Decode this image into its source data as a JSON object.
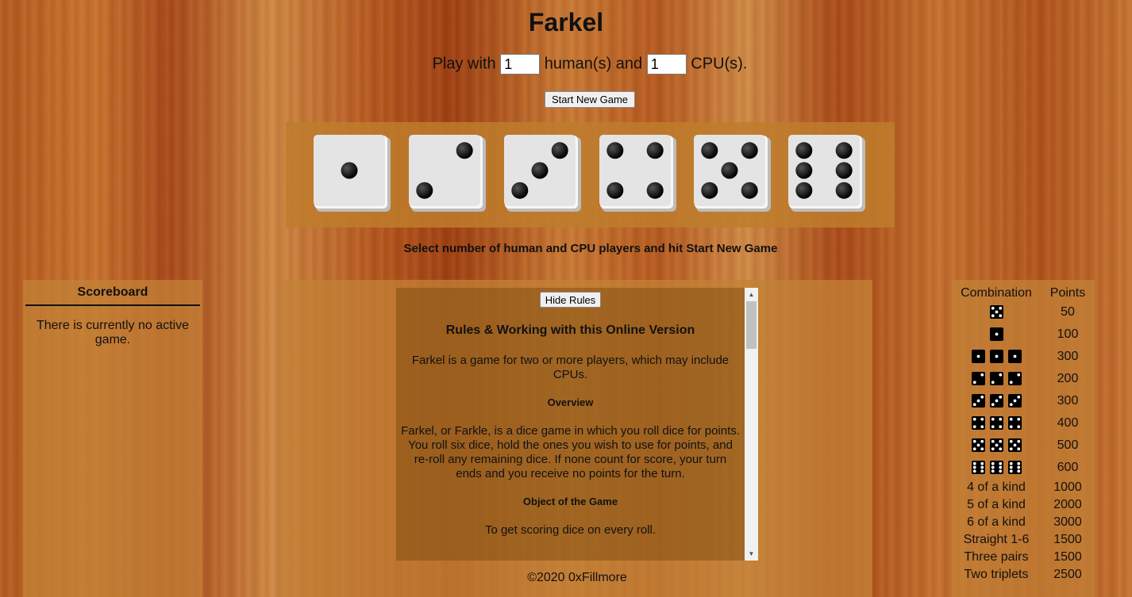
{
  "header": {
    "title": "Farkel",
    "play_with": "Play with",
    "humans_label": "human(s) and",
    "cpus_label": "CPU(s).",
    "humans_value": "1",
    "cpus_value": "1",
    "start_button": "Start New Game"
  },
  "dice": [
    1,
    2,
    3,
    4,
    5,
    6
  ],
  "status_message": "Select number of human and CPU players and hit Start New Game",
  "scoreboard": {
    "title": "Scoreboard",
    "message": "There is currently no active game."
  },
  "rules": {
    "hide_button": "Hide Rules",
    "heading": "Rules & Working with this Online Version",
    "intro": "Farkel is a game for two or more players, which may include CPUs.",
    "overview_heading": "Overview",
    "overview_text": "Farkel, or Farkle, is a dice game in which you roll dice for points. You roll six dice, hold the ones you wish to use for points, and re-roll any remaining dice. If none count for score, your turn ends and you receive no points for the turn.",
    "object_heading": "Object of the Game",
    "object_text": "To get scoring dice on every roll."
  },
  "footer": {
    "copyright": "©2020 0xFillmore"
  },
  "scoring": {
    "col_combination": "Combination",
    "col_points": "Points",
    "dice_rows": [
      {
        "dice": [
          5
        ],
        "points": "50"
      },
      {
        "dice": [
          1
        ],
        "points": "100"
      },
      {
        "dice": [
          1,
          1,
          1
        ],
        "points": "300"
      },
      {
        "dice": [
          2,
          2,
          2
        ],
        "points": "200"
      },
      {
        "dice": [
          3,
          3,
          3
        ],
        "points": "300"
      },
      {
        "dice": [
          4,
          4,
          4
        ],
        "points": "400"
      },
      {
        "dice": [
          5,
          5,
          5
        ],
        "points": "500"
      },
      {
        "dice": [
          6,
          6,
          6
        ],
        "points": "600"
      }
    ],
    "text_rows": [
      {
        "label": "4 of a kind",
        "points": "1000"
      },
      {
        "label": "5 of a kind",
        "points": "2000"
      },
      {
        "label": "6 of a kind",
        "points": "3000"
      },
      {
        "label": "Straight 1-6",
        "points": "1500"
      },
      {
        "label": "Three pairs",
        "points": "1500"
      },
      {
        "label": "Two triplets",
        "points": "2500"
      }
    ]
  }
}
